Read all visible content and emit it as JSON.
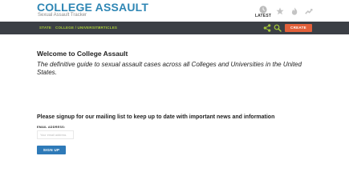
{
  "brand": {
    "title": "COLLEGE ASSAULT",
    "subtitle": "Sexual Assault Tracker"
  },
  "header": {
    "latest_label": "LATEST",
    "trend_icons": [
      "clock-icon",
      "star-icon",
      "flame-icon",
      "trending-icon"
    ]
  },
  "nav": {
    "items": [
      "STATE",
      "COLLEGE / UNIVERSITY",
      "ARTICLES"
    ],
    "create_label": "CREATE"
  },
  "main": {
    "welcome": "Welcome to College Assault",
    "tagline": "The definitive guide to sexual assault cases across all Colleges and Universities in the United States."
  },
  "signup": {
    "heading": "Please signup for our mailing list to keep up to date with important news and information",
    "email_label": "EMAIL ADDRESS:",
    "email_placeholder": "Your email address",
    "email_value": "",
    "button_label": "SIGN UP"
  },
  "colors": {
    "brand": "#2e86b4",
    "nav_bg": "#3b3f45",
    "nav_text": "#a6c93a",
    "create_bg": "#e2603a",
    "signup_bg": "#2e7ab8"
  }
}
